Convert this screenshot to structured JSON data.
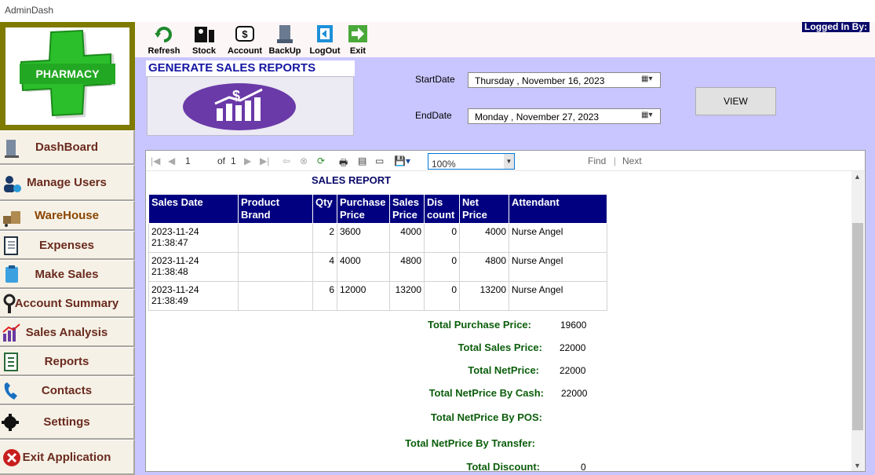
{
  "window": {
    "title": "AdminDash"
  },
  "logo": {
    "text": "PHARMACY"
  },
  "sidebar": {
    "items": [
      {
        "label": "DashBoard",
        "icon": "server-icon"
      },
      {
        "label": "Manage Users",
        "icon": "users-icon"
      },
      {
        "label": "WareHouse",
        "icon": "warehouse-icon"
      },
      {
        "label": "Expenses",
        "icon": "receipt-icon"
      },
      {
        "label": "Make Sales",
        "icon": "clipboard-icon"
      },
      {
        "label": "Account Summary",
        "icon": "key-icon"
      },
      {
        "label": "Sales Analysis",
        "icon": "chart-icon"
      },
      {
        "label": "Reports",
        "icon": "report-icon"
      },
      {
        "label": "Contacts",
        "icon": "phone-icon"
      },
      {
        "label": "Settings",
        "icon": "gear-icon"
      },
      {
        "label": "Exit Application",
        "icon": "close-icon"
      }
    ]
  },
  "toolbar": {
    "refresh": "Refresh",
    "stock": "Stock",
    "account": "Account",
    "backup": "BackUp",
    "logout": "LogOut",
    "exit": "Exit",
    "logged_in": "Logged In By:"
  },
  "generate": {
    "title": "GENERATE SALES REPORTS FROM"
  },
  "dates": {
    "start_label": "StartDate",
    "start_value": "Thursday  , November 16, 2023",
    "end_label": "EndDate",
    "end_value": "Monday   , November 27, 2023",
    "view_label": "VIEW"
  },
  "viewer": {
    "page": "1",
    "of": "of",
    "total_pages": "1",
    "zoom": "100%",
    "find": "Find",
    "sep": "|",
    "next": "Next"
  },
  "report": {
    "title": "SALES REPORT",
    "columns": [
      "Sales Date",
      "Product Brand",
      "Qty",
      "Purchase Price",
      "Sales Price",
      "Dis count",
      "Net Price",
      "Attendant"
    ],
    "rows": [
      {
        "date": "2023-11-24 21:38:47",
        "brand": "",
        "qty": "2",
        "purchase": "3600",
        "sales": "4000",
        "discount": "0",
        "net": "4000",
        "attendant": "Nurse Angel"
      },
      {
        "date": "2023-11-24 21:38:48",
        "brand": "",
        "qty": "4",
        "purchase": "4000",
        "sales": "4800",
        "discount": "0",
        "net": "4800",
        "attendant": "Nurse Angel"
      },
      {
        "date": "2023-11-24 21:38:49",
        "brand": "",
        "qty": "6",
        "purchase": "12000",
        "sales": "13200",
        "discount": "0",
        "net": "13200",
        "attendant": "Nurse Angel"
      }
    ],
    "totals": [
      {
        "label": "Total Purchase Price:",
        "value": "19600"
      },
      {
        "label": "Total Sales Price:",
        "value": "22000"
      },
      {
        "label": "Total NetPrice:",
        "value": "22000"
      },
      {
        "label": "Total NetPrice By Cash:",
        "value": "22000"
      },
      {
        "label": "Total NetPrice By POS:",
        "value": ""
      },
      {
        "label": "Total NetPrice By Transfer:",
        "value": ""
      },
      {
        "label": "Total Discount:",
        "value": "0"
      }
    ]
  }
}
